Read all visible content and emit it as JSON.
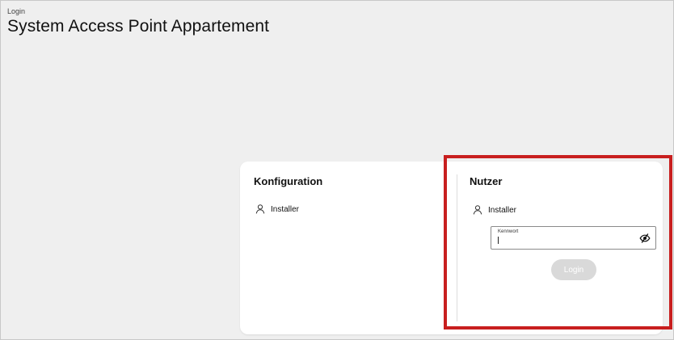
{
  "header": {
    "breadcrumb": "Login",
    "title": "System Access Point Appartement"
  },
  "card": {
    "left_section": {
      "title": "Konfiguration",
      "user_label": "Installer",
      "user_icon": "user-icon"
    },
    "right_section": {
      "title": "Nutzer",
      "user_label": "Installer",
      "user_icon": "user-icon",
      "password": {
        "label": "Kennwort",
        "value": "",
        "toggle_icon": "eye-slash-icon"
      },
      "login_button_label": "Login"
    }
  },
  "colors": {
    "page_background": "#efefef",
    "card_background": "#ffffff",
    "button_disabled": "#d9d9d9",
    "highlight": "#c81f1f"
  }
}
